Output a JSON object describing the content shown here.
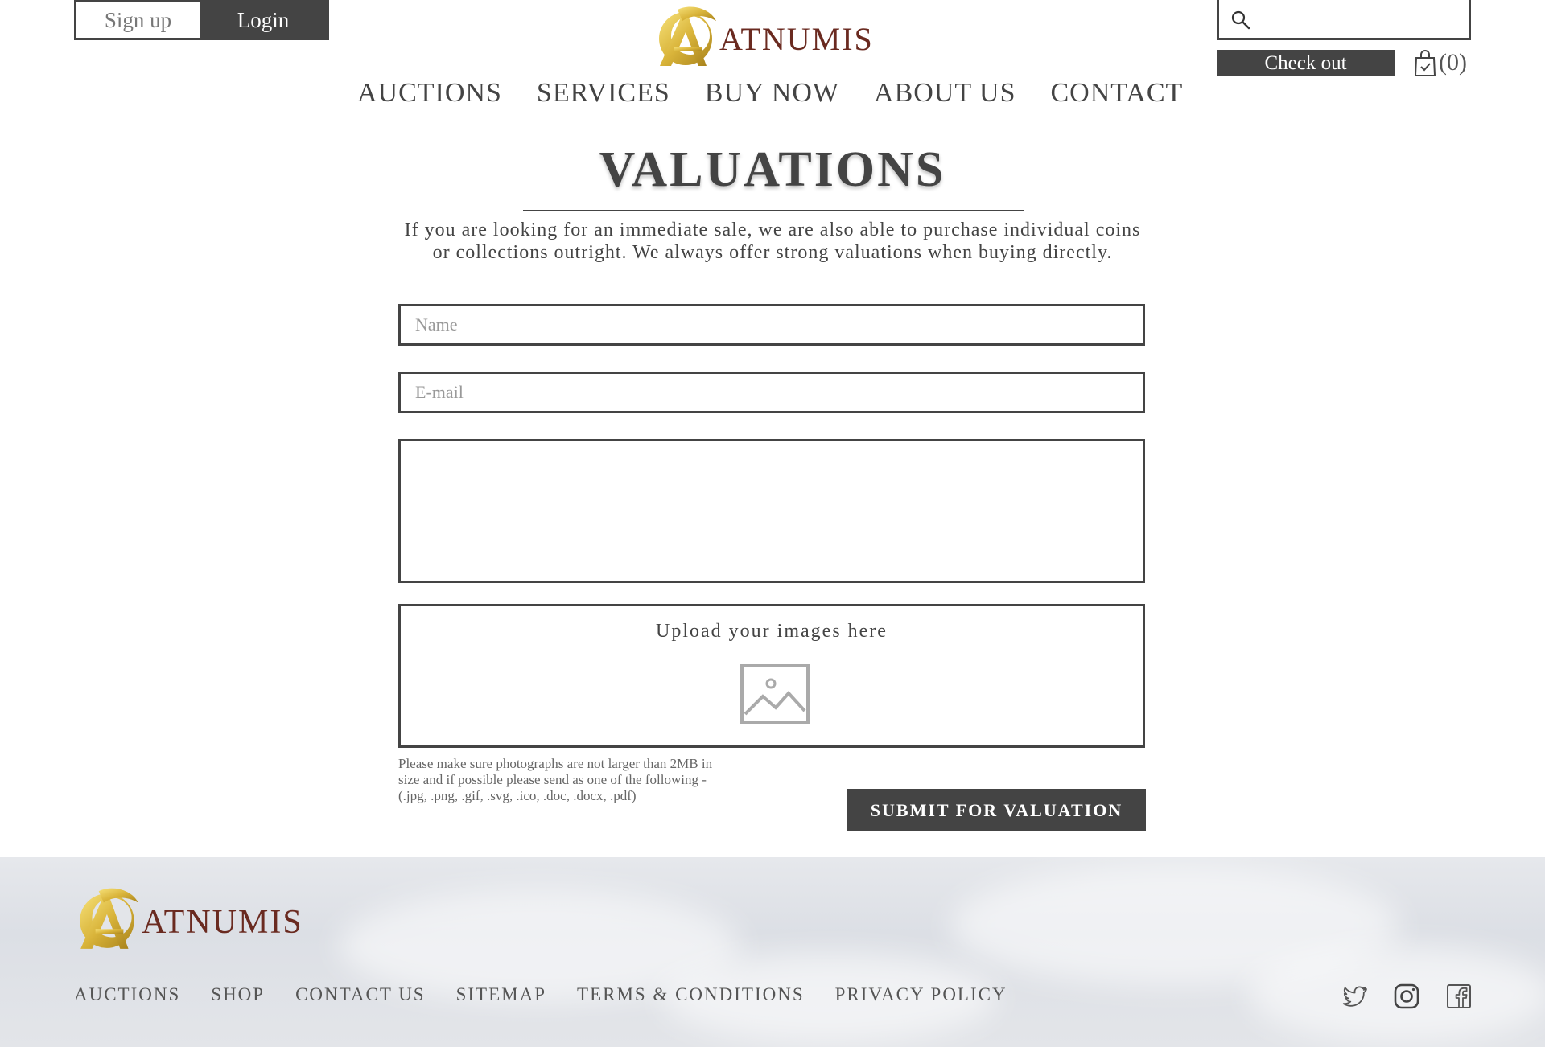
{
  "header": {
    "auth": {
      "signup_label": "Sign up",
      "login_label": "Login"
    },
    "logo": {
      "wordmark": "ATNUMIS"
    },
    "search": {
      "placeholder": ""
    },
    "checkout_label": "Check out",
    "cart": {
      "count_text": "(0)"
    },
    "nav": [
      {
        "label": "AUCTIONS"
      },
      {
        "label": "SERVICES"
      },
      {
        "label": "BUY NOW"
      },
      {
        "label": "ABOUT US"
      },
      {
        "label": "CONTACT"
      }
    ],
    "icons": {
      "search": "search-icon",
      "cart": "shopping-bag-icon"
    }
  },
  "main": {
    "title": "VALUATIONS",
    "intro_line1": "If you are looking for an immediate sale, we are also able to purchase individual coins",
    "intro_line2": "or collections outright. We always offer strong valuations when buying directly.",
    "form": {
      "name_placeholder": "Name",
      "email_placeholder": "E-mail",
      "message_placeholder": "",
      "upload_label": "Upload your images here",
      "upload_note_line1": "Please make sure photographs are not larger than 2MB in",
      "upload_note_line2": "size and if possible please send as one of the following -",
      "upload_note_line3": "(.jpg, .png, .gif, .svg, .ico, .doc, .docx, .pdf)",
      "submit_label": "SUBMIT FOR VALUATION"
    }
  },
  "footer": {
    "logo_wordmark": "ATNUMIS",
    "nav": [
      {
        "label": "AUCTIONS"
      },
      {
        "label": "SHOP"
      },
      {
        "label": "CONTACT US"
      },
      {
        "label": "SITEMAP"
      },
      {
        "label": "TERMS & CONDITIONS"
      },
      {
        "label": "PRIVACY POLICY"
      }
    ],
    "social": [
      "twitter-icon",
      "instagram-icon",
      "facebook-icon"
    ]
  },
  "colors": {
    "primary_dark": "#444444",
    "brand_gold": "#d9b43a",
    "brand_wordmark": "#6a2a20"
  }
}
